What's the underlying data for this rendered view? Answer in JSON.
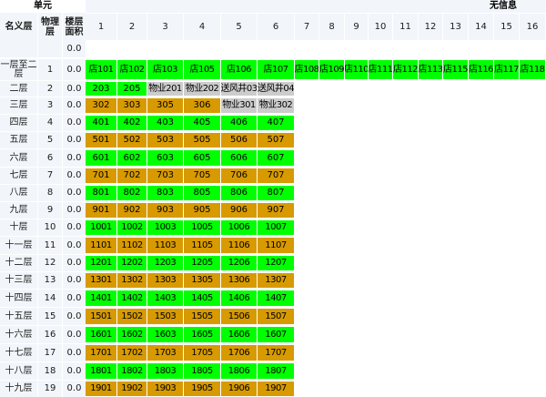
{
  "header": {
    "unit_label": "单元",
    "no_info_label": "无信息",
    "col_name": "名义层",
    "col_physical": "物理层",
    "col_area": "楼层面积",
    "columns": [
      "1",
      "2",
      "3",
      "4",
      "5",
      "6",
      "7",
      "8",
      "9",
      "10",
      "11",
      "12",
      "13",
      "14",
      "15",
      "16"
    ]
  },
  "colors": {
    "green": "#00ff00",
    "orange": "#d79a00",
    "gray": "#cccccc"
  },
  "rows": [
    {
      "name": "",
      "phys": "",
      "area": "0.0",
      "cells": []
    },
    {
      "name": "一层至二层",
      "phys": "1",
      "area": "0.0",
      "cells": [
        {
          "t": "店101",
          "c": "g"
        },
        {
          "t": "店102",
          "c": "g"
        },
        {
          "t": "店103",
          "c": "g"
        },
        {
          "t": "店105",
          "c": "g"
        },
        {
          "t": "店106",
          "c": "g"
        },
        {
          "t": "店107",
          "c": "g"
        },
        {
          "t": "店108",
          "c": "g"
        },
        {
          "t": "店109",
          "c": "g"
        },
        {
          "t": "店110",
          "c": "g"
        },
        {
          "t": "店111",
          "c": "g"
        },
        {
          "t": "店112",
          "c": "g"
        },
        {
          "t": "店113",
          "c": "g"
        },
        {
          "t": "店115",
          "c": "g"
        },
        {
          "t": "店116",
          "c": "g"
        },
        {
          "t": "店117",
          "c": "g"
        },
        {
          "t": "店118",
          "c": "g"
        }
      ]
    },
    {
      "name": "二层",
      "phys": "2",
      "area": "0.0",
      "cells": [
        {
          "t": "203",
          "c": "g"
        },
        {
          "t": "205",
          "c": "g"
        },
        {
          "t": "物业201",
          "c": "y"
        },
        {
          "t": "物业202",
          "c": "y"
        },
        {
          "t": "送风井03",
          "c": "y"
        },
        {
          "t": "送风井04",
          "c": "y"
        }
      ]
    },
    {
      "name": "三层",
      "phys": "3",
      "area": "0.0",
      "cells": [
        {
          "t": "302",
          "c": "o"
        },
        {
          "t": "303",
          "c": "o"
        },
        {
          "t": "305",
          "c": "o"
        },
        {
          "t": "306",
          "c": "o"
        },
        {
          "t": "物业301",
          "c": "y"
        },
        {
          "t": "物业302",
          "c": "y"
        }
      ]
    },
    {
      "name": "四层",
      "phys": "4",
      "area": "0.0",
      "cells": [
        {
          "t": "401",
          "c": "g"
        },
        {
          "t": "402",
          "c": "g"
        },
        {
          "t": "403",
          "c": "g"
        },
        {
          "t": "405",
          "c": "g"
        },
        {
          "t": "406",
          "c": "g"
        },
        {
          "t": "407",
          "c": "g"
        }
      ]
    },
    {
      "name": "五层",
      "phys": "5",
      "area": "0.0",
      "cells": [
        {
          "t": "501",
          "c": "o"
        },
        {
          "t": "502",
          "c": "o"
        },
        {
          "t": "503",
          "c": "o"
        },
        {
          "t": "505",
          "c": "o"
        },
        {
          "t": "506",
          "c": "o"
        },
        {
          "t": "507",
          "c": "o"
        }
      ]
    },
    {
      "name": "六层",
      "phys": "6",
      "area": "0.0",
      "cells": [
        {
          "t": "601",
          "c": "g"
        },
        {
          "t": "602",
          "c": "g"
        },
        {
          "t": "603",
          "c": "g"
        },
        {
          "t": "605",
          "c": "g"
        },
        {
          "t": "606",
          "c": "g"
        },
        {
          "t": "607",
          "c": "g"
        }
      ]
    },
    {
      "name": "七层",
      "phys": "7",
      "area": "0.0",
      "cells": [
        {
          "t": "701",
          "c": "o"
        },
        {
          "t": "702",
          "c": "o"
        },
        {
          "t": "703",
          "c": "o"
        },
        {
          "t": "705",
          "c": "o"
        },
        {
          "t": "706",
          "c": "o"
        },
        {
          "t": "707",
          "c": "o"
        }
      ]
    },
    {
      "name": "八层",
      "phys": "8",
      "area": "0.0",
      "cells": [
        {
          "t": "801",
          "c": "g"
        },
        {
          "t": "802",
          "c": "g"
        },
        {
          "t": "803",
          "c": "g"
        },
        {
          "t": "805",
          "c": "g"
        },
        {
          "t": "806",
          "c": "g"
        },
        {
          "t": "807",
          "c": "g"
        }
      ]
    },
    {
      "name": "九层",
      "phys": "9",
      "area": "0.0",
      "cells": [
        {
          "t": "901",
          "c": "o"
        },
        {
          "t": "902",
          "c": "o"
        },
        {
          "t": "903",
          "c": "o"
        },
        {
          "t": "905",
          "c": "o"
        },
        {
          "t": "906",
          "c": "o"
        },
        {
          "t": "907",
          "c": "o"
        }
      ]
    },
    {
      "name": "十层",
      "phys": "10",
      "area": "0.0",
      "cells": [
        {
          "t": "1001",
          "c": "g"
        },
        {
          "t": "1002",
          "c": "g"
        },
        {
          "t": "1003",
          "c": "g"
        },
        {
          "t": "1005",
          "c": "g"
        },
        {
          "t": "1006",
          "c": "g"
        },
        {
          "t": "1007",
          "c": "g"
        }
      ]
    },
    {
      "name": "十一层",
      "phys": "11",
      "area": "0.0",
      "cells": [
        {
          "t": "1101",
          "c": "o"
        },
        {
          "t": "1102",
          "c": "o"
        },
        {
          "t": "1103",
          "c": "o"
        },
        {
          "t": "1105",
          "c": "o"
        },
        {
          "t": "1106",
          "c": "o"
        },
        {
          "t": "1107",
          "c": "o"
        }
      ]
    },
    {
      "name": "十二层",
      "phys": "12",
      "area": "0.0",
      "cells": [
        {
          "t": "1201",
          "c": "g"
        },
        {
          "t": "1202",
          "c": "g"
        },
        {
          "t": "1203",
          "c": "g"
        },
        {
          "t": "1205",
          "c": "g"
        },
        {
          "t": "1206",
          "c": "g"
        },
        {
          "t": "1207",
          "c": "g"
        }
      ]
    },
    {
      "name": "十三层",
      "phys": "13",
      "area": "0.0",
      "cells": [
        {
          "t": "1301",
          "c": "o"
        },
        {
          "t": "1302",
          "c": "o"
        },
        {
          "t": "1303",
          "c": "o"
        },
        {
          "t": "1305",
          "c": "o"
        },
        {
          "t": "1306",
          "c": "o"
        },
        {
          "t": "1307",
          "c": "o"
        }
      ]
    },
    {
      "name": "十四层",
      "phys": "14",
      "area": "0.0",
      "cells": [
        {
          "t": "1401",
          "c": "g"
        },
        {
          "t": "1402",
          "c": "g"
        },
        {
          "t": "1403",
          "c": "g"
        },
        {
          "t": "1405",
          "c": "g"
        },
        {
          "t": "1406",
          "c": "g"
        },
        {
          "t": "1407",
          "c": "g"
        }
      ]
    },
    {
      "name": "十五层",
      "phys": "15",
      "area": "0.0",
      "cells": [
        {
          "t": "1501",
          "c": "o"
        },
        {
          "t": "1502",
          "c": "o"
        },
        {
          "t": "1503",
          "c": "o"
        },
        {
          "t": "1505",
          "c": "o"
        },
        {
          "t": "1506",
          "c": "o"
        },
        {
          "t": "1507",
          "c": "o"
        }
      ]
    },
    {
      "name": "十六层",
      "phys": "16",
      "area": "0.0",
      "cells": [
        {
          "t": "1601",
          "c": "g"
        },
        {
          "t": "1602",
          "c": "g"
        },
        {
          "t": "1603",
          "c": "g"
        },
        {
          "t": "1605",
          "c": "g"
        },
        {
          "t": "1606",
          "c": "g"
        },
        {
          "t": "1607",
          "c": "g"
        }
      ]
    },
    {
      "name": "十七层",
      "phys": "17",
      "area": "0.0",
      "cells": [
        {
          "t": "1701",
          "c": "o"
        },
        {
          "t": "1702",
          "c": "o"
        },
        {
          "t": "1703",
          "c": "o"
        },
        {
          "t": "1705",
          "c": "o"
        },
        {
          "t": "1706",
          "c": "o"
        },
        {
          "t": "1707",
          "c": "o"
        }
      ]
    },
    {
      "name": "十八层",
      "phys": "18",
      "area": "0.0",
      "cells": [
        {
          "t": "1801",
          "c": "g"
        },
        {
          "t": "1802",
          "c": "g"
        },
        {
          "t": "1803",
          "c": "g"
        },
        {
          "t": "1805",
          "c": "g"
        },
        {
          "t": "1806",
          "c": "g"
        },
        {
          "t": "1807",
          "c": "g"
        }
      ]
    },
    {
      "name": "十九层",
      "phys": "19",
      "area": "0.0",
      "cells": [
        {
          "t": "1901",
          "c": "o"
        },
        {
          "t": "1902",
          "c": "o"
        },
        {
          "t": "1903",
          "c": "o"
        },
        {
          "t": "1905",
          "c": "o"
        },
        {
          "t": "1906",
          "c": "o"
        },
        {
          "t": "1907",
          "c": "o"
        }
      ]
    }
  ]
}
